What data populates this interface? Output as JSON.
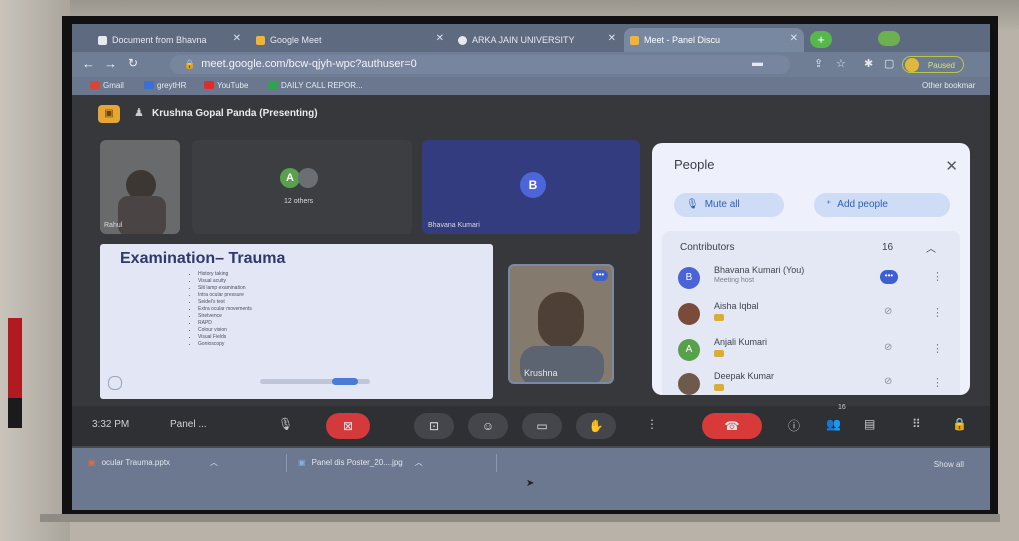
{
  "tabs": [
    {
      "label": "Document from Bhavna",
      "icon": "docs-icon",
      "close": "✕"
    },
    {
      "label": "Google Meet",
      "icon": "meet-icon",
      "close": "✕"
    },
    {
      "label": "ARKA JAIN UNIVERSITY",
      "icon": "university-icon",
      "close": "✕"
    },
    {
      "label": "Meet - Panel Discu",
      "icon": "meet-icon",
      "close": "✕"
    }
  ],
  "newtab_label": "+",
  "address": {
    "url": "meet.google.com/bcw-qjyh-wpc?authuser=0"
  },
  "profile_label": "Paused",
  "bookmarks": [
    {
      "label": "Gmail",
      "color": "#d44638"
    },
    {
      "label": "greytHR",
      "color": "#3a6fd8"
    },
    {
      "label": "YouTube",
      "color": "#e02b2b"
    },
    {
      "label": "DAILY CALL REPOR...",
      "color": "#2fa44f"
    }
  ],
  "other_bookmarks": "Other bookmar",
  "meet": {
    "presenting": "Krushna Gopal Panda (Presenting)",
    "tiles": {
      "cam_label": "Rahul",
      "others_label": "12 others",
      "others_avatar": "A",
      "bhavana_avatar": "B",
      "bhavana_label": "Bhavana Kumari",
      "krushna_label": "Krushna"
    },
    "slide": {
      "title": "Examination– Trauma",
      "bullets": [
        "History taking",
        "Visual acuity",
        "Slit lamp examination",
        "Intra ocular pressure",
        "Seidel's test",
        "Extra ocular movements",
        "Stretvence",
        "RAPD",
        "Colour vision",
        "Visual Fields",
        "Gonioscopy"
      ]
    }
  },
  "people": {
    "title": "People",
    "close": "✕",
    "mute_all": "Mute all",
    "add_people": "Add people",
    "section": "Contributors",
    "count": "16",
    "rows": [
      {
        "name": "Bhavana Kumari (You)",
        "sub": "Meeting host",
        "avatar": "B",
        "color": "#4a63d6"
      },
      {
        "name": "Aisha Iqbal",
        "sub": "",
        "avatar": "",
        "color": "#7a4b3a"
      },
      {
        "name": "Anjali Kumari",
        "sub": "",
        "avatar": "A",
        "color": "#58a14b"
      },
      {
        "name": "Deepak Kumar",
        "sub": "",
        "avatar": "",
        "color": "#6d5a4a"
      }
    ]
  },
  "controls": {
    "time": "3:32 PM",
    "meeting_name": "Panel ...",
    "people_count": "16"
  },
  "downloads": [
    {
      "label": "ocular Trauma.pptx"
    },
    {
      "label": "Panel dis Poster_20....jpg"
    }
  ],
  "show_all": "Show all"
}
